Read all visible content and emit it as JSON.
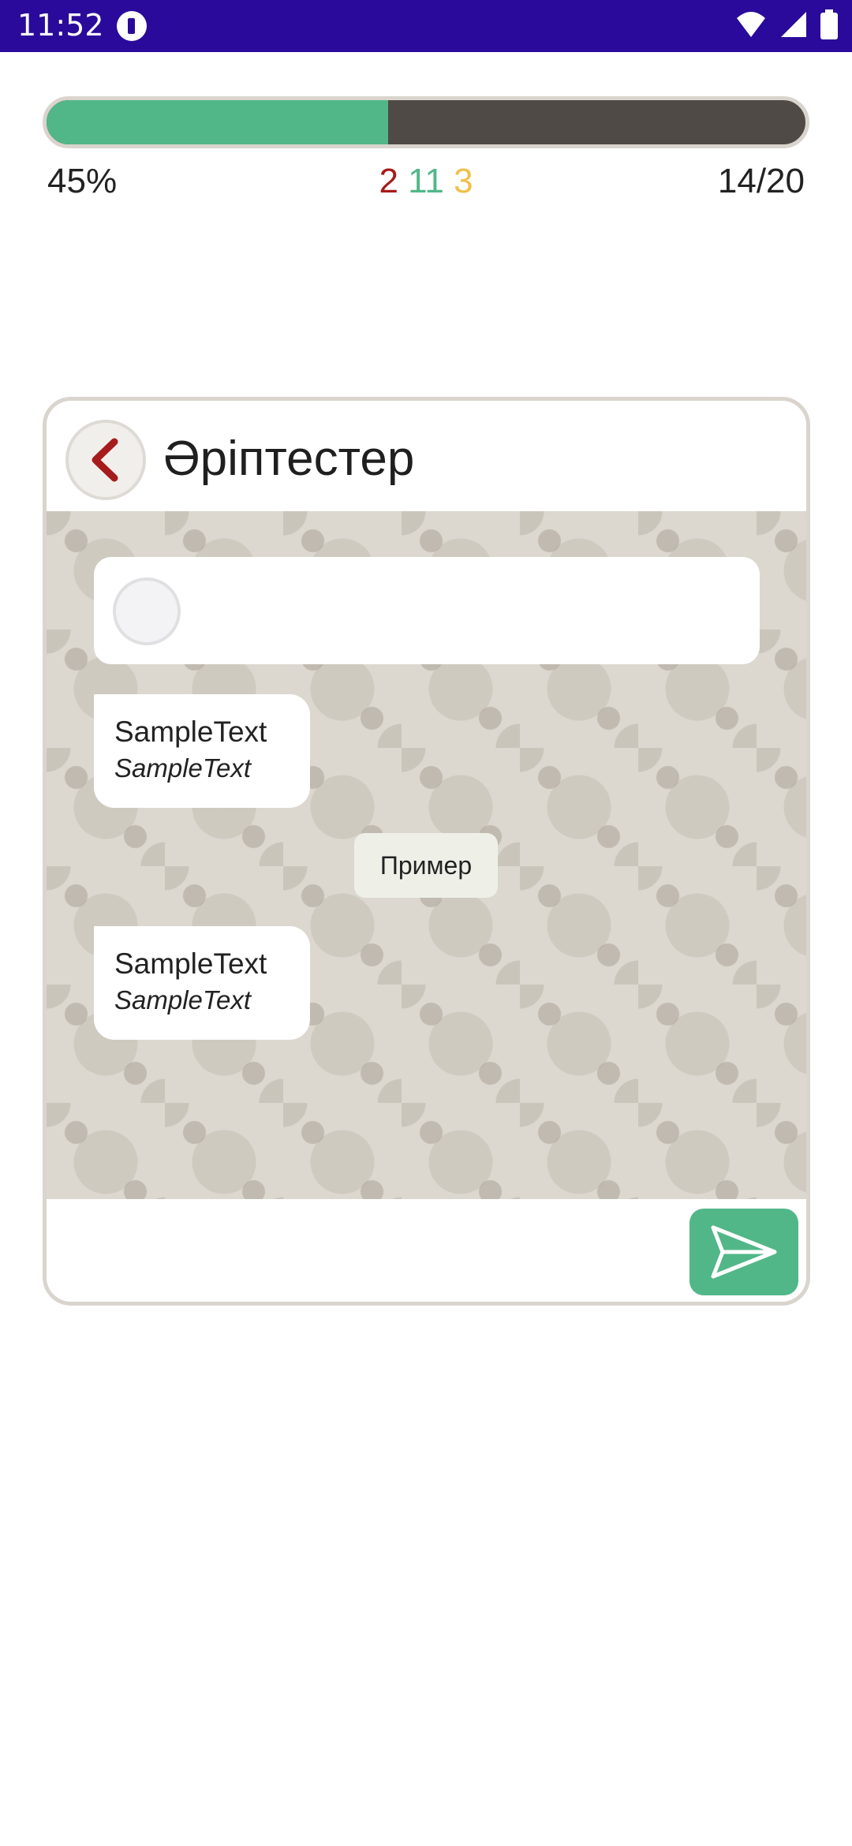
{
  "status_bar": {
    "time": "11:52",
    "icons": [
      "app-notification-icon",
      "wifi-icon",
      "signal-icon",
      "battery-icon"
    ]
  },
  "progress": {
    "percent_label": "45%",
    "fraction": 0.45,
    "wrong_count": "2",
    "correct_count": "11",
    "skipped_count": "3",
    "step_label": "14/20"
  },
  "chat": {
    "title": "Әріптестер",
    "messages": [
      {
        "title": "SampleText",
        "subtitle": "SampleText"
      },
      {
        "title": "SampleText",
        "subtitle": "SampleText"
      }
    ],
    "example_label": "Пример"
  },
  "colors": {
    "status_bar": "#2a0a9a",
    "accent_green": "#52b788",
    "track_dark": "#4f4a45",
    "wrong_red": "#a61b1b",
    "skip_yellow": "#f0c04a"
  }
}
